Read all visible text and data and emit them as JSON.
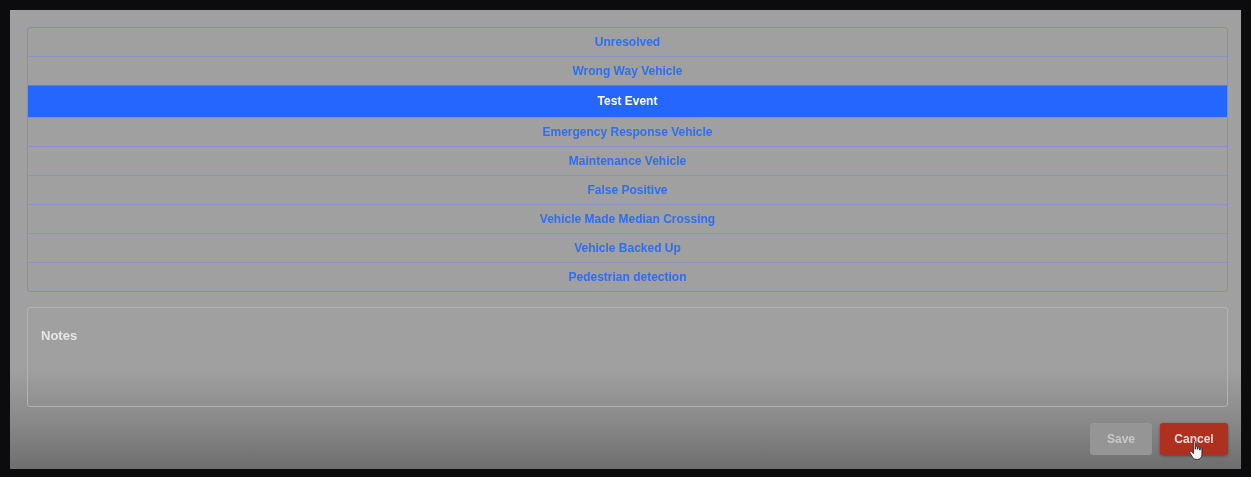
{
  "options": [
    {
      "label": "Unresolved",
      "selected": false
    },
    {
      "label": "Wrong Way Vehicle",
      "selected": false
    },
    {
      "label": "Test Event",
      "selected": true
    },
    {
      "label": "Emergency Response Vehicle",
      "selected": false
    },
    {
      "label": "Maintenance Vehicle",
      "selected": false
    },
    {
      "label": "False Positive",
      "selected": false
    },
    {
      "label": "Vehicle Made Median Crossing",
      "selected": false
    },
    {
      "label": "Vehicle Backed Up",
      "selected": false
    },
    {
      "label": "Pedestrian detection",
      "selected": false
    }
  ],
  "notes": {
    "label": "Notes"
  },
  "buttons": [
    {
      "label": "Save",
      "kind": "save",
      "disabled": true
    },
    {
      "label": "Cancel",
      "kind": "cancel",
      "disabled": false
    }
  ]
}
